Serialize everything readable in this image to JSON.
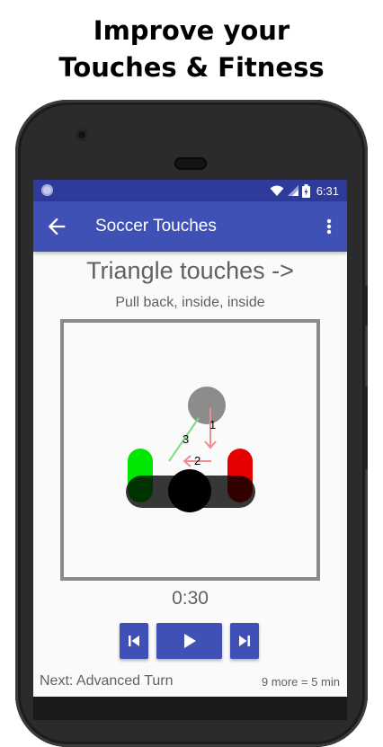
{
  "promo": {
    "line1": "Improve your",
    "line2": "Touches & Fitness"
  },
  "status_bar": {
    "time": "6:31",
    "icons": [
      "wifi-icon",
      "signal-icon",
      "battery-icon"
    ]
  },
  "app_bar": {
    "title": "Soccer Touches",
    "back_icon": "arrow-back-icon",
    "menu_icon": "more-vert-icon"
  },
  "exercise": {
    "title": "Triangle touches ->",
    "subtitle": "Pull back, inside, inside",
    "steps": [
      "1",
      "2",
      "3"
    ]
  },
  "player": {
    "timer": "0:30",
    "prev_icon": "skip-previous-icon",
    "play_icon": "play-icon",
    "next_icon": "skip-next-icon"
  },
  "footer": {
    "next": "Next: Advanced Turn",
    "remaining": "9 more = 5 min"
  },
  "colors": {
    "status_bar": "#2e3b9b",
    "app_bar": "#3f51b5",
    "button": "#3f51b5",
    "left_foot": "#00e600",
    "right_foot": "#e60000",
    "ball": "#8c8c8c"
  }
}
